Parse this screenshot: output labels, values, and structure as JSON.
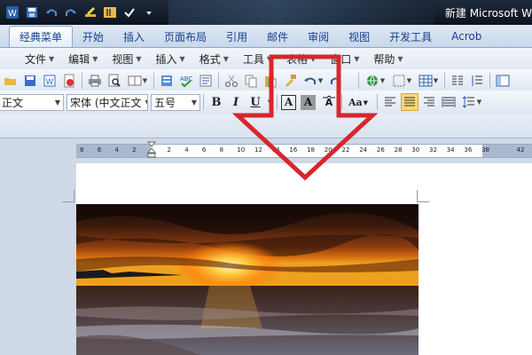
{
  "window": {
    "title": "新建 Microsoft W"
  },
  "ribbon_tabs": [
    {
      "label": "经典菜单",
      "active": true
    },
    {
      "label": "开始",
      "active": false
    },
    {
      "label": "插入",
      "active": false
    },
    {
      "label": "页面布局",
      "active": false
    },
    {
      "label": "引用",
      "active": false
    },
    {
      "label": "邮件",
      "active": false
    },
    {
      "label": "审阅",
      "active": false
    },
    {
      "label": "视图",
      "active": false
    },
    {
      "label": "开发工具",
      "active": false
    },
    {
      "label": "Acrob",
      "active": false
    }
  ],
  "menubar": [
    {
      "label": "文件"
    },
    {
      "label": "编辑"
    },
    {
      "label": "视图"
    },
    {
      "label": "插入"
    },
    {
      "label": "格式"
    },
    {
      "label": "工具"
    },
    {
      "label": "表格"
    },
    {
      "label": "窗口"
    },
    {
      "label": "帮助"
    }
  ],
  "format_toolbar": {
    "style_value": "正文",
    "font_value": "宋体 (中文正文",
    "size_value": "五号",
    "bold_label": "B",
    "italic_label": "I",
    "underline_label": "U",
    "char_border_label": "A",
    "char_shading_label": "A",
    "change_case_label": "Aa"
  },
  "ruler": {
    "ticks": [
      "8",
      "6",
      "4",
      "2",
      "",
      "2",
      "4",
      "6",
      "8",
      "10",
      "12",
      "14",
      "16",
      "18",
      "20",
      "22",
      "24",
      "26",
      "28",
      "30",
      "32",
      "34",
      "36",
      "38",
      "",
      "42"
    ]
  },
  "colors": {
    "accent": "#15428b",
    "arrow": "#d8262c",
    "highlight": "#f6d87a"
  },
  "icons": {
    "annotation": "down-arrow-overlay",
    "image": "sunset-beach-photo"
  }
}
